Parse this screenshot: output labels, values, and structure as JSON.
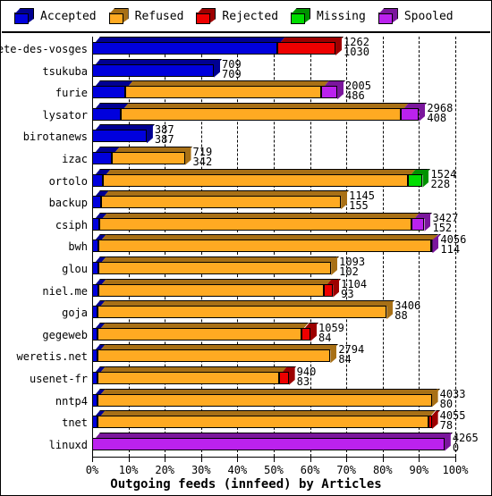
{
  "legend": {
    "items": [
      {
        "label": "Accepted",
        "color": "#0000dd",
        "icon": "cube-icon"
      },
      {
        "label": "Refused",
        "color": "#ffaa22",
        "icon": "cube-icon"
      },
      {
        "label": "Rejected",
        "color": "#ee0000",
        "icon": "cube-icon"
      },
      {
        "label": "Missing",
        "color": "#00dd00",
        "icon": "cube-icon"
      },
      {
        "label": "Spooled",
        "color": "#bb22ee",
        "icon": "cube-icon"
      }
    ]
  },
  "axis": {
    "title": "Outgoing feeds (innfeed) by Articles",
    "xticks": [
      "0%",
      "10%",
      "20%",
      "30%",
      "40%",
      "50%",
      "60%",
      "70%",
      "80%",
      "90%",
      "100%"
    ]
  },
  "chart_data": {
    "type": "bar",
    "orientation": "horizontal",
    "stacked": true,
    "title": "Outgoing feeds (innfeed) by Articles",
    "xlabel": "Outgoing feeds (innfeed) by Articles",
    "ylabel": "",
    "xlim": [
      0,
      100
    ],
    "xunit": "percent",
    "xticks": [
      0,
      10,
      20,
      30,
      40,
      50,
      60,
      70,
      80,
      90,
      100
    ],
    "grid": true,
    "legend_position": "top",
    "series": [
      {
        "name": "Accepted",
        "color": "#0000dd"
      },
      {
        "name": "Refused",
        "color": "#ffaa22"
      },
      {
        "name": "Rejected",
        "color": "#ee0000"
      },
      {
        "name": "Missing",
        "color": "#00dd00"
      },
      {
        "name": "Spooled",
        "color": "#bb22ee"
      }
    ],
    "categories": [
      "bete-des-vosges",
      "tsukuba",
      "furie",
      "lysator",
      "birotanews",
      "izac",
      "ortolo",
      "backup",
      "csiph",
      "bwh",
      "glou",
      "niel.me",
      "goja",
      "gegeweb",
      "weretis.net",
      "usenet-fr",
      "nntp4",
      "tnet",
      "linuxd"
    ],
    "rows": [
      {
        "label": "bete-des-vosges",
        "top_value": "1262",
        "bottom_value": "1030",
        "segments": [
          {
            "series": "Accepted",
            "pct": 51.0
          },
          {
            "series": "Rejected",
            "pct": 16.0
          }
        ]
      },
      {
        "label": "tsukuba",
        "top_value": "709",
        "bottom_value": "709",
        "segments": [
          {
            "series": "Accepted",
            "pct": 33.5
          }
        ]
      },
      {
        "label": "furie",
        "top_value": "2005",
        "bottom_value": "486",
        "segments": [
          {
            "series": "Accepted",
            "pct": 9.0
          },
          {
            "series": "Refused",
            "pct": 54.0
          },
          {
            "series": "Spooled",
            "pct": 4.5
          }
        ]
      },
      {
        "label": "lysator",
        "top_value": "2968",
        "bottom_value": "408",
        "segments": [
          {
            "series": "Accepted",
            "pct": 8.0
          },
          {
            "series": "Refused",
            "pct": 77.0
          },
          {
            "series": "Spooled",
            "pct": 5.0
          }
        ]
      },
      {
        "label": "birotanews",
        "top_value": "387",
        "bottom_value": "387",
        "segments": [
          {
            "series": "Accepted",
            "pct": 15.0
          }
        ]
      },
      {
        "label": "izac",
        "top_value": "719",
        "bottom_value": "342",
        "segments": [
          {
            "series": "Accepted",
            "pct": 5.5
          },
          {
            "series": "Refused",
            "pct": 20.0
          }
        ]
      },
      {
        "label": "ortolo",
        "top_value": "1524",
        "bottom_value": "228",
        "segments": [
          {
            "series": "Accepted",
            "pct": 3.0
          },
          {
            "series": "Refused",
            "pct": 84.0
          },
          {
            "series": "Missing",
            "pct": 4.0
          }
        ]
      },
      {
        "label": "backup",
        "top_value": "1145",
        "bottom_value": "155",
        "segments": [
          {
            "series": "Accepted",
            "pct": 2.5
          },
          {
            "series": "Refused",
            "pct": 66.0
          }
        ]
      },
      {
        "label": "csiph",
        "top_value": "3427",
        "bottom_value": "152",
        "segments": [
          {
            "series": "Accepted",
            "pct": 2.0
          },
          {
            "series": "Refused",
            "pct": 86.0
          },
          {
            "series": "Spooled",
            "pct": 3.5
          }
        ]
      },
      {
        "label": "bwh",
        "top_value": "4056",
        "bottom_value": "114",
        "segments": [
          {
            "series": "Accepted",
            "pct": 1.8
          },
          {
            "series": "Refused",
            "pct": 91.5
          },
          {
            "series": "Spooled",
            "pct": 0.4
          }
        ]
      },
      {
        "label": "glou",
        "top_value": "1093",
        "bottom_value": "102",
        "segments": [
          {
            "series": "Accepted",
            "pct": 1.8
          },
          {
            "series": "Refused",
            "pct": 64.0
          }
        ]
      },
      {
        "label": "niel.me",
        "top_value": "1104",
        "bottom_value": "93",
        "segments": [
          {
            "series": "Accepted",
            "pct": 1.8
          },
          {
            "series": "Refused",
            "pct": 62.0
          },
          {
            "series": "Rejected",
            "pct": 2.5
          }
        ]
      },
      {
        "label": "goja",
        "top_value": "3406",
        "bottom_value": "88",
        "segments": [
          {
            "series": "Accepted",
            "pct": 1.6
          },
          {
            "series": "Refused",
            "pct": 79.5
          }
        ]
      },
      {
        "label": "gegeweb",
        "top_value": "1059",
        "bottom_value": "84",
        "segments": [
          {
            "series": "Accepted",
            "pct": 1.6
          },
          {
            "series": "Refused",
            "pct": 56.0
          },
          {
            "series": "Rejected",
            "pct": 2.5
          }
        ]
      },
      {
        "label": "weretis.net",
        "top_value": "2794",
        "bottom_value": "84",
        "segments": [
          {
            "series": "Accepted",
            "pct": 1.6
          },
          {
            "series": "Refused",
            "pct": 64.0
          }
        ]
      },
      {
        "label": "usenet-fr",
        "top_value": "940",
        "bottom_value": "83",
        "segments": [
          {
            "series": "Accepted",
            "pct": 1.6
          },
          {
            "series": "Refused",
            "pct": 50.0
          },
          {
            "series": "Rejected",
            "pct": 2.5
          }
        ]
      },
      {
        "label": "nntp4",
        "top_value": "4033",
        "bottom_value": "80",
        "segments": [
          {
            "series": "Accepted",
            "pct": 1.5
          },
          {
            "series": "Refused",
            "pct": 92.0
          }
        ]
      },
      {
        "label": "tnet",
        "top_value": "4055",
        "bottom_value": "78",
        "segments": [
          {
            "series": "Accepted",
            "pct": 1.5
          },
          {
            "series": "Refused",
            "pct": 91.0
          },
          {
            "series": "Rejected",
            "pct": 1.0
          }
        ]
      },
      {
        "label": "linuxd",
        "top_value": "4265",
        "bottom_value": "0",
        "segments": [
          {
            "series": "Spooled",
            "pct": 97.0
          }
        ]
      }
    ]
  }
}
